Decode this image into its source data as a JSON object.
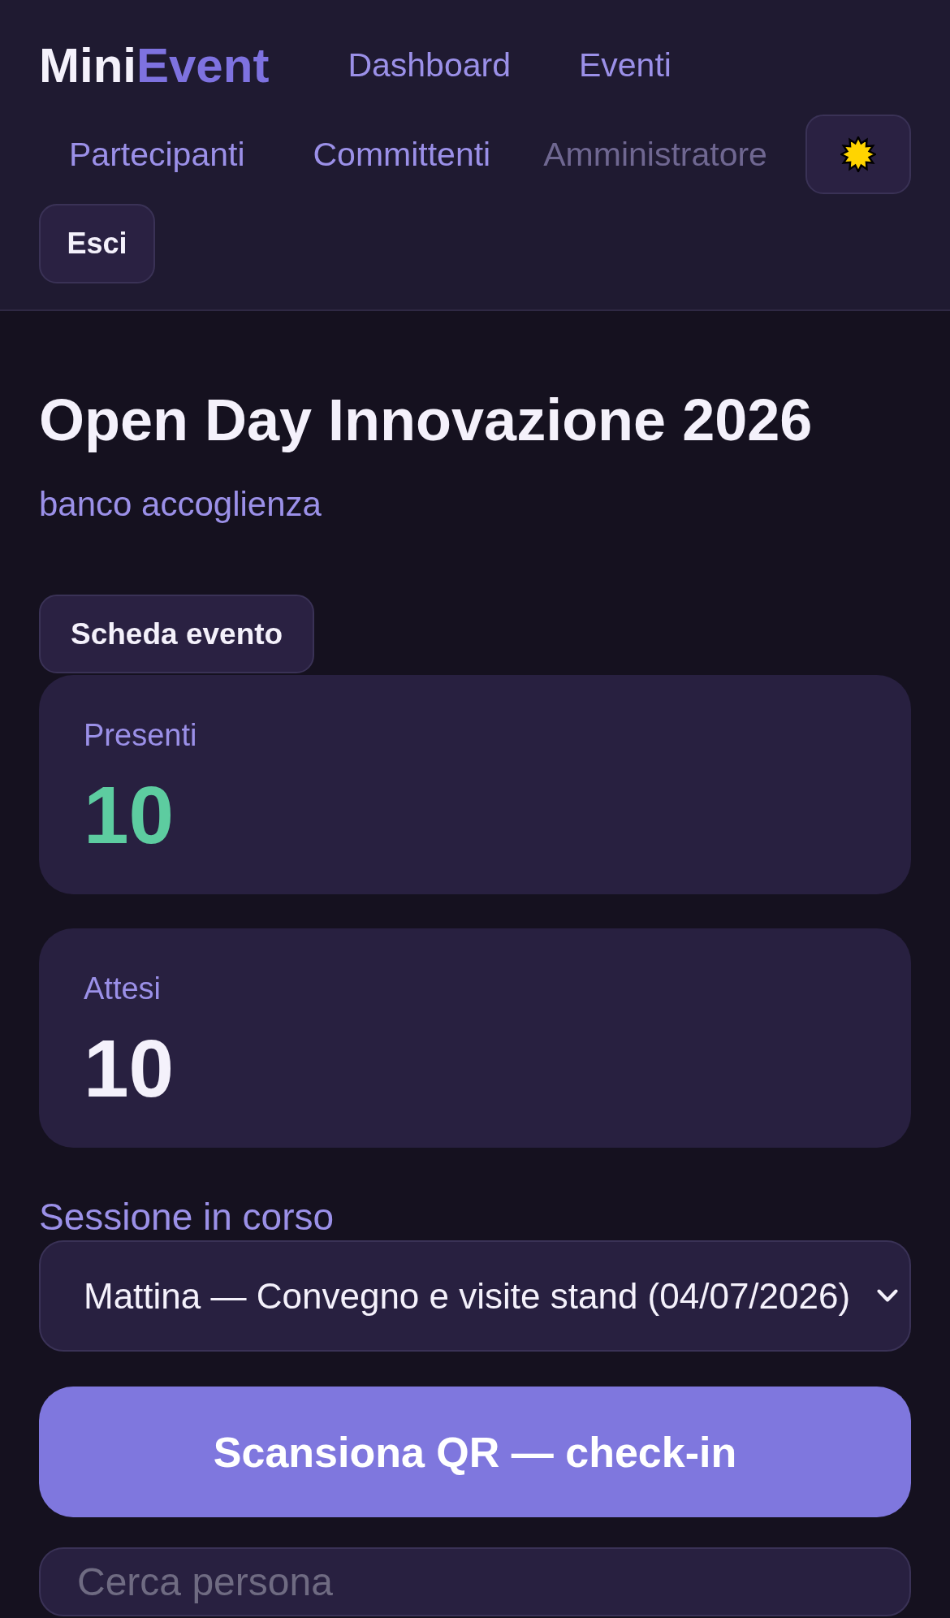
{
  "header": {
    "logo": {
      "text": "Mini",
      "highlight": "Event"
    },
    "nav_links": [
      "Dashboard",
      "Eventi",
      "Partecipanti",
      "Committenti"
    ],
    "user_role": "Amministratore",
    "logout_button": "Esci"
  },
  "event": {
    "title": "Open Day Innovazione 2026",
    "subtitle": "banco accoglienza",
    "details_button": "Scheda evento"
  },
  "stats": [
    {
      "label": "Presenti",
      "value": "10",
      "color": "#5dcca0"
    },
    {
      "label": "Attesi",
      "value": "10",
      "color": "#f4f1fb"
    }
  ],
  "session": {
    "label": "Sessione in corso",
    "value": "Mattina — Convegno e visite stand (04/07/2026)"
  },
  "scan_button": "Scansiona QR — check-in",
  "search": {
    "placeholder": "Cerca persona"
  }
}
